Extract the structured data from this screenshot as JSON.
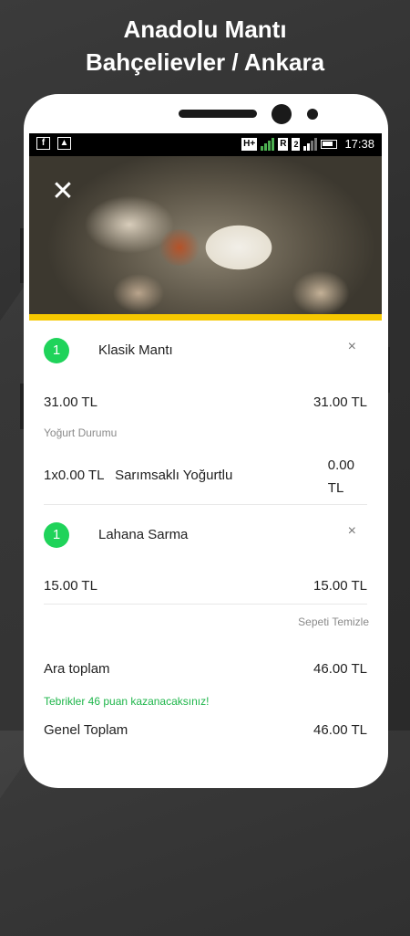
{
  "header": {
    "title_line1": "Anadolu Mantı",
    "title_line2": "Bahçelievler / Ankara"
  },
  "status_bar": {
    "network_tag": "H+",
    "roaming_tag": "R",
    "sim2": "2",
    "time": "17:38",
    "icons": [
      "facebook-icon",
      "image-icon",
      "signal-icon",
      "battery-icon"
    ]
  },
  "cart": {
    "items": [
      {
        "qty": "1",
        "name": "Klasik Mantı",
        "remove": "×",
        "unit_price": "31.00 TL",
        "total_price": "31.00 TL",
        "option_group": "Yoğurt Durumu",
        "option_line": "1x0.00 TL",
        "option_name": "Sarımsaklı Yoğurtlu",
        "option_price_line1": "0.00",
        "option_price_line2": "TL"
      },
      {
        "qty": "1",
        "name": "Lahana Sarma",
        "remove": "×",
        "unit_price": "15.00 TL",
        "total_price": "15.00 TL"
      }
    ],
    "clear_label": "Sepeti Temizle",
    "subtotal_label": "Ara toplam",
    "subtotal_value": "46.00 TL",
    "promo_text": "Tebrikler 46 puan kazanacaksınız!",
    "grand_label": "Genel Toplam",
    "grand_value": "46.00 TL"
  },
  "colors": {
    "accent_yellow": "#f6c800",
    "badge_green": "#1fd35a",
    "promo_green": "#1fb64b",
    "background": "#333333"
  },
  "close_icon": "close-icon"
}
